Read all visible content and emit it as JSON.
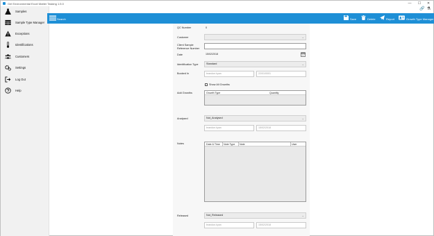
{
  "window": {
    "title": "Gel Environmental Excel Matter Tasking 1.5.0",
    "minimize": "—",
    "maximize": "☐",
    "close": "✕"
  },
  "sidebar": {
    "items": [
      {
        "label": "Samples",
        "icon": "flask-icon"
      },
      {
        "label": "Sample Type Manager",
        "icon": "table-icon"
      },
      {
        "label": "Exceptions",
        "icon": "warning-icon"
      },
      {
        "label": "Identifications",
        "icon": "thermometer-icon"
      },
      {
        "label": "Customers",
        "icon": "users-icon"
      },
      {
        "label": "Settings",
        "icon": "gears-icon"
      },
      {
        "label": "Log Out",
        "icon": "logout-icon"
      },
      {
        "label": "Help",
        "icon": "help-icon"
      }
    ]
  },
  "toolbar": {
    "search_label": "Search",
    "save_label": "Save",
    "delete_label": "Delete",
    "report_label": "Report",
    "growth_type_label": "Growth Type Manager",
    "color": "#1e8fd6"
  },
  "form": {
    "qc_number": {
      "label": "QC Number",
      "value": "0"
    },
    "customer": {
      "label": "Customer",
      "value": ""
    },
    "client_ref": {
      "label_line1": "Client Sample",
      "label_line2": "Reference Number",
      "value": ""
    },
    "date": {
      "label": "Date",
      "value": "15/02/2018"
    },
    "identification_type": {
      "label": "Identification Type",
      "value": "Standard"
    },
    "booked_in": {
      "label": "Booked In",
      "user_placeholder": "brandon.kyan",
      "date_placeholder": "22/01/0001"
    },
    "show_all_growths": {
      "label": "Show All Growths",
      "checked": false
    },
    "add_growths": {
      "label": "Add Growths",
      "columns": [
        "Growth Type",
        "Quantity"
      ]
    },
    "analysed": {
      "label": "Analysed",
      "value": "Not_Analysed",
      "user_placeholder": "brandon.kyan",
      "date_placeholder": "15/02/2018"
    },
    "notes": {
      "label": "Notes",
      "columns": [
        "Date & Time",
        "Note Type",
        "Note",
        "User"
      ]
    },
    "released": {
      "label": "Released",
      "value": "Not_Released",
      "user_placeholder": "brandon.kyan",
      "date_placeholder": "15/02/2018"
    }
  }
}
